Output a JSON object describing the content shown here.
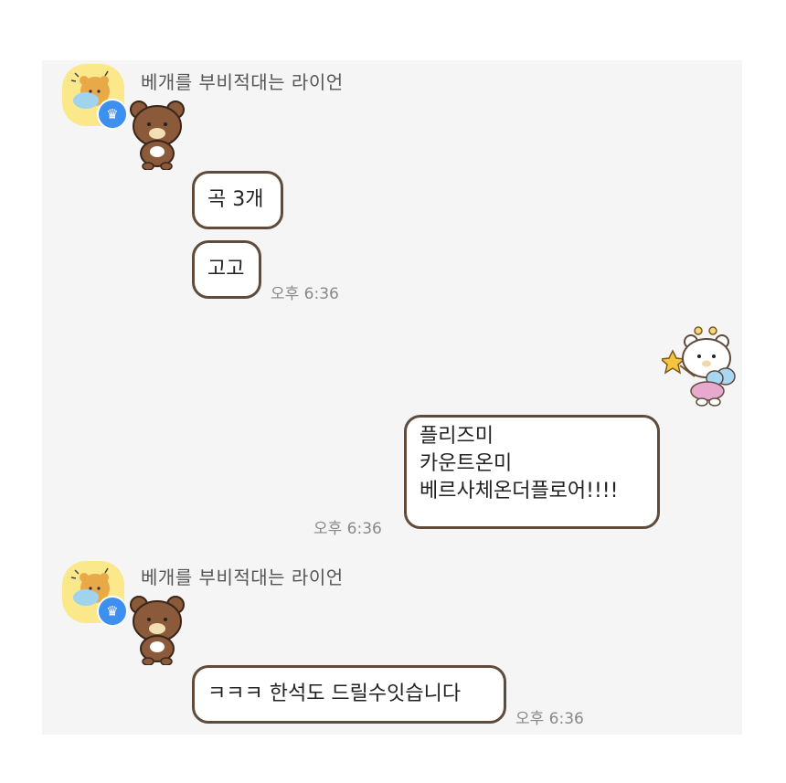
{
  "chat": {
    "groups": [
      {
        "sender": "베개를 부비적대는 라이언",
        "messages": [
          "곡 3개",
          "고고"
        ],
        "time": "오후 6:36"
      },
      {
        "self": true,
        "sticker": "korilakkuma-fairy-sticker",
        "lines": [
          "플리즈미",
          "카운트온미",
          "베르사체온더플로어!!!!"
        ],
        "time": "오후 6:36"
      },
      {
        "sender": "베개를 부비적대는 라이언",
        "messages": [
          "ㅋㅋㅋ 한석도 드릴수잇습니다"
        ],
        "time": "오후 6:36"
      }
    ],
    "colors": {
      "background": "#f5f5f5",
      "bubble_border": "#5e4b3c",
      "badge": "#3d8ff0",
      "avatar_bg": "#fbe88b"
    }
  }
}
